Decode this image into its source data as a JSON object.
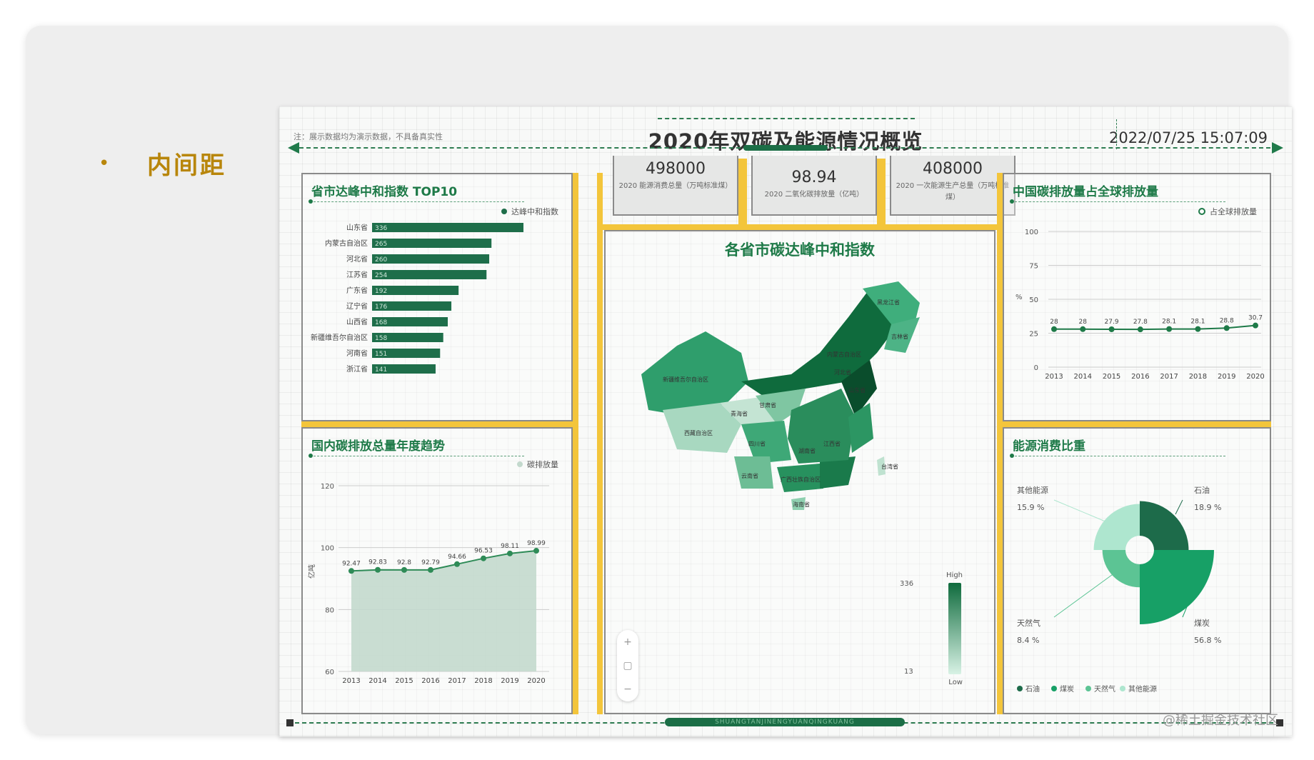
{
  "slide": {
    "bullet": "•",
    "heading": "内间距",
    "watermark": "@稀土掘金技术社区"
  },
  "dashboard": {
    "note": "注：展示数据均为演示数据，不具备真实性",
    "title": "2020年双碳及能源情况概览",
    "datetime": "2022/07/25 15:07:09",
    "footer_text": "SHUANGTANJINENGYUANQINGKUANG"
  },
  "kpis": [
    {
      "value": "498000",
      "label": "2020 能源消费总量（万吨标准煤）"
    },
    {
      "value": "98.94",
      "label": "2020 二氧化碳排放量（亿吨）"
    },
    {
      "value": "408000",
      "label": "2020 一次能源生产总量（万吨标准煤）"
    }
  ],
  "panels": {
    "top10_title": "省市达峰中和指数 TOP10",
    "top10_legend": "达峰中和指数",
    "trend_title": "国内碳排放总量年度趋势",
    "trend_legend": "碳排放量",
    "map_title": "各省市碳达峰中和指数",
    "global_title": "中国碳排放量占全球排放量",
    "global_legend": "占全球排放量",
    "energy_title": "能源消费比重"
  },
  "map": {
    "scale_high": "High",
    "scale_low": "Low",
    "scale_max": "336",
    "scale_min": "13",
    "zoom_in": "+",
    "zoom_reset": "▢",
    "zoom_out": "−",
    "labels": [
      "新疆维吾尔自治区",
      "内蒙古自治区",
      "西藏自治区",
      "青海省",
      "甘肃省",
      "四川省",
      "云南省",
      "广西壮族自治区",
      "江西省",
      "湖南省",
      "台湾省",
      "海南省",
      "山东省",
      "河北省",
      "黑龙江省",
      "吉林省"
    ]
  },
  "chart_data": [
    {
      "type": "bar",
      "title": "省市达峰中和指数 TOP10",
      "series": [
        {
          "name": "达峰中和指数",
          "values": [
            336,
            265,
            260,
            254,
            192,
            176,
            168,
            158,
            151,
            141
          ]
        }
      ],
      "categories": [
        "山东省",
        "内蒙古自治区",
        "河北省",
        "江苏省",
        "广东省",
        "辽宁省",
        "山西省",
        "新疆维吾尔自治区",
        "河南省",
        "浙江省"
      ],
      "color": "#1e6e4a"
    },
    {
      "type": "area",
      "title": "国内碳排放总量年度趋势",
      "x": [
        "2013",
        "2014",
        "2015",
        "2016",
        "2017",
        "2018",
        "2019",
        "2020"
      ],
      "series": [
        {
          "name": "碳排放量",
          "values": [
            92.47,
            92.83,
            92.8,
            92.79,
            94.66,
            96.53,
            98.11,
            98.99
          ]
        }
      ],
      "ylabel": "亿吨",
      "ylim": [
        60,
        120
      ],
      "yticks": [
        60,
        80,
        100,
        120
      ],
      "color": "#2e8b57",
      "fill": "#c3d9cd"
    },
    {
      "type": "line",
      "title": "中国碳排放量占全球排放量",
      "x": [
        "2013",
        "2014",
        "2015",
        "2016",
        "2017",
        "2018",
        "2019",
        "2020"
      ],
      "series": [
        {
          "name": "占全球排放量",
          "values": [
            28,
            28,
            27.9,
            27.8,
            28.1,
            28.1,
            28.8,
            30.7
          ]
        }
      ],
      "ylabel": "%",
      "ylim": [
        0,
        100
      ],
      "yticks": [
        0,
        25,
        50,
        75,
        100
      ],
      "color": "#1e7a48"
    },
    {
      "type": "pie",
      "title": "能源消费比重",
      "categories": [
        "石油",
        "煤炭",
        "天然气",
        "其他能源"
      ],
      "values": [
        18.9,
        56.8,
        8.4,
        15.9
      ],
      "labels": [
        "18.9 %",
        "56.8 %",
        "8.4 %",
        "15.9 %"
      ],
      "colors": [
        "#1d6b4a",
        "#17a066",
        "#5cc494",
        "#aee6cf"
      ]
    }
  ]
}
